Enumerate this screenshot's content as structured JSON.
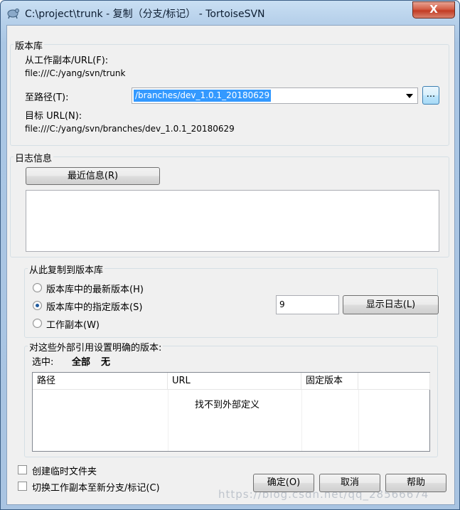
{
  "window": {
    "title": "C:\\project\\trunk - 复制（分支/标记） - TortoiseSVN",
    "close_label": "X"
  },
  "repository": {
    "group_title": "版本库",
    "from_label": "从工作副本/URL(F):",
    "from_value": "file:///C:/yang/svn/trunk",
    "to_label": "至路径(T):",
    "to_value": "/branches/dev_1.0.1_20180629",
    "browse_label": "...",
    "target_label": "目标 URL(N):",
    "target_value": "file:///C:/yang/svn/branches/dev_1.0.1_20180629"
  },
  "log": {
    "group_title": "日志信息",
    "recent_button": "最近信息(R)",
    "message_value": ""
  },
  "copy_from": {
    "group_title": "从此复制到版本库",
    "options": [
      {
        "label": "版本库中的最新版本(H)",
        "checked": false
      },
      {
        "label": "版本库中的指定版本(S)",
        "checked": true
      },
      {
        "label": "工作副本(W)",
        "checked": false
      }
    ],
    "revision_value": "9",
    "show_log_button": "显示日志(L)"
  },
  "externals": {
    "group_title": "对这些外部引用设置明确的版本:",
    "select_label": "选中:",
    "select_all": "全部",
    "select_none": "无",
    "columns": [
      "路径",
      "URL",
      "固定版本",
      ""
    ],
    "empty_text": "找不到外部定义"
  },
  "footer": {
    "create_temp_label": "创建临时文件夹",
    "switch_label": "切换工作副本至新分支/标记(C)",
    "ok_button": "确定(O)",
    "cancel_button": "取消",
    "help_button": "帮助",
    "watermark": "https://blog.csdn.net/qq_28566674"
  }
}
